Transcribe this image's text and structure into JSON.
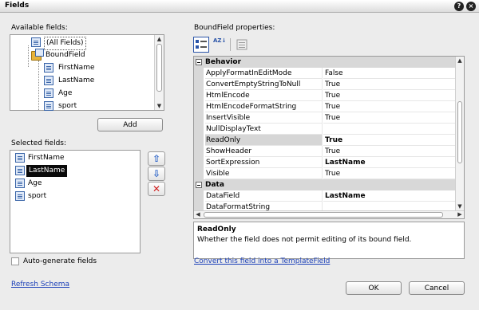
{
  "window": {
    "title": "Fields",
    "help_glyph": "?",
    "close_glyph": "×"
  },
  "available": {
    "label": "Available fields:",
    "items": [
      {
        "label": "(All Fields)",
        "icon": "field-icon"
      },
      {
        "label": "BoundField",
        "icon": "boundfield-icon"
      },
      {
        "label": "FirstName",
        "icon": "field-icon"
      },
      {
        "label": "LastName",
        "icon": "field-icon"
      },
      {
        "label": "Age",
        "icon": "field-icon"
      },
      {
        "label": "sport",
        "icon": "field-icon"
      }
    ],
    "add_label": "Add"
  },
  "selected": {
    "label": "Selected fields:",
    "items": [
      {
        "label": "FirstName"
      },
      {
        "label": "LastName",
        "selected": true
      },
      {
        "label": "Age"
      },
      {
        "label": "sport"
      }
    ],
    "up_glyph": "⇧",
    "down_glyph": "⇩",
    "delete_glyph": "✕"
  },
  "autogen_label": "Auto-generate fields",
  "refresh_label": "Refresh Schema",
  "properties": {
    "label": "BoundField properties:",
    "az_glyph": "AZ↓",
    "categories": [
      {
        "name": "Behavior",
        "rows": [
          {
            "name": "ApplyFormatInEditMode",
            "value": "False"
          },
          {
            "name": "ConvertEmptyStringToNull",
            "value": "True"
          },
          {
            "name": "HtmlEncode",
            "value": "True"
          },
          {
            "name": "HtmlEncodeFormatString",
            "value": "True"
          },
          {
            "name": "InsertVisible",
            "value": "True"
          },
          {
            "name": "NullDisplayText",
            "value": ""
          },
          {
            "name": "ReadOnly",
            "value": "True",
            "selected": true,
            "bold": true
          },
          {
            "name": "ShowHeader",
            "value": "True"
          },
          {
            "name": "SortExpression",
            "value": "LastName",
            "bold": true
          },
          {
            "name": "Visible",
            "value": "True"
          }
        ]
      },
      {
        "name": "Data",
        "rows": [
          {
            "name": "DataField",
            "value": "LastName",
            "bold": true
          },
          {
            "name": "DataFormatString",
            "value": ""
          }
        ]
      }
    ],
    "description": {
      "title": "ReadOnly",
      "text": "Whether the field does not permit editing of its bound field."
    }
  },
  "convert_link": "Convert this field into a TemplateField",
  "ok_label": "OK",
  "cancel_label": "Cancel",
  "colors": {
    "selection": "#0a0a0a",
    "link": "#1a3fb8",
    "arrow": "#2c64c8",
    "delete": "#d02020"
  }
}
